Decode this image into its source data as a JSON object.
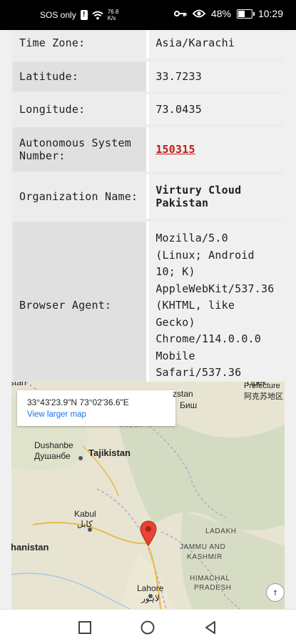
{
  "status_bar": {
    "network_text": "SOS only",
    "speed_value": "76.8",
    "speed_unit": "K/s",
    "battery_percent": "48%",
    "battery_level": 0.48,
    "time": "10:29",
    "icons": [
      "alert-icon",
      "wifi-icon",
      "key-icon",
      "eye-icon",
      "battery-icon"
    ]
  },
  "info_rows": [
    {
      "label": "Time Zone:",
      "value": "Asia/Karachi"
    },
    {
      "label": "Latitude:",
      "value": "33.7233"
    },
    {
      "label": "Longitude:",
      "value": "73.0435"
    },
    {
      "label_line1": "Autonomous System",
      "label_line2": "Number:",
      "value": "150315"
    },
    {
      "label": "Organization Name:",
      "value_line1": "Virtury Cloud",
      "value_line2": "Pakistan"
    },
    {
      "label": "Browser Agent:",
      "value_lines": [
        "Mozilla/5.0",
        "(Linux; Android",
        "10; K)",
        "AppleWebKit/537.36",
        "(KHTML, like",
        "Gecko)",
        "Chrome/114.0.0.0",
        "Mobile",
        "Safari/537.36"
      ]
    }
  ],
  "map": {
    "coords": "33°43'23.9\"N 73°02'36.6\"E",
    "view_larger": "View larger map",
    "labels": {
      "top_left": "stan",
      "top_center": "zstan",
      "top_center_ru": "Биш",
      "top_right": "Прек",
      "prefecture": "Prefecture",
      "prefecture_cn": "阿克苏地区",
      "dushanbe": "Dushanbe",
      "dushanbe_ru": "Душанбе",
      "tajikistan": "Tajikistan",
      "kabul": "Kabul",
      "kabul_ps": "کابل",
      "afghanistan": "hanistan",
      "ladakh": "LADAKH",
      "jammu": "JAMMU AND",
      "kashmir": "KASHMIR",
      "himachal": "HIMACHAL",
      "pradesh": "PRADESH",
      "lahore": "Lahore",
      "lahore_ur": "لاہور"
    }
  },
  "colors": {
    "accent_red": "#c31919",
    "link_blue": "#1a73e8",
    "marker_red": "#ea4335"
  }
}
